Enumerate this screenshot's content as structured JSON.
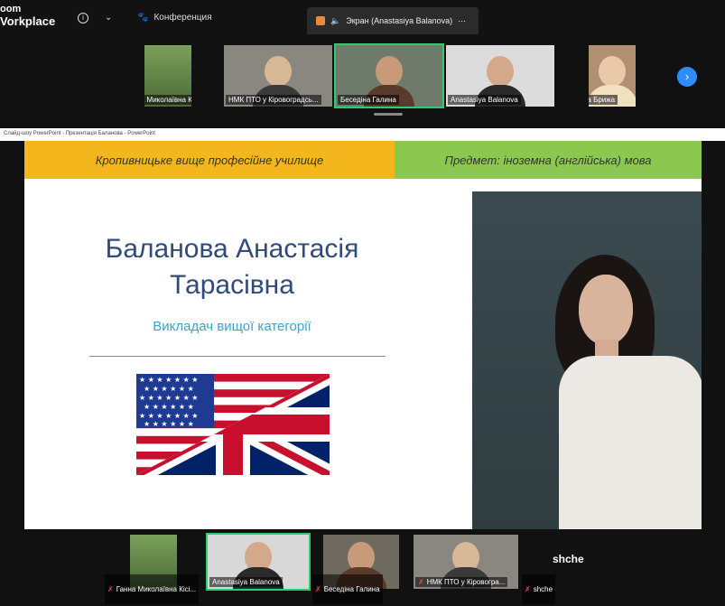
{
  "app": {
    "brand_line1": "oom",
    "brand_line2": "Vorkplace"
  },
  "topbar": {
    "conference_label": "Конференция",
    "screen_label": "Экран (Anastasiya Balanova)"
  },
  "participants_top": [
    {
      "name": "Ганна Миколаївна Кісі..."
    },
    {
      "name": "НМК ПТО у Кіровоградсь..."
    },
    {
      "name": "Беседіна Галина"
    },
    {
      "name": "Anastasiya Balanova"
    },
    {
      "name": "Ольга Брижа"
    }
  ],
  "powerpoint_title": "Слайд-шоу PowerPoint - Презентація Баланова - PowerPoint",
  "slide": {
    "header_left": "Кропивницьке вище професійне училище",
    "header_right": "Предмет: іноземна (англійська) мова",
    "name": "Баланова Анастасія Тарасівна",
    "role": "Викладач вищої категорії"
  },
  "participants_bottom": [
    {
      "name": "Ганна Миколаївна Кісі..."
    },
    {
      "name": "Anastasiya Balanova"
    },
    {
      "name": "Беседіна Галина"
    },
    {
      "name": "НМК ПТО у Кіровогра..."
    },
    {
      "name": "shche"
    }
  ],
  "bottom_name_label": "shche",
  "colors": {
    "accent": "#2d8cff",
    "active_speaker": "#2ecc71",
    "header_left_bg": "#f3b61c",
    "header_right_bg": "#8cc850"
  }
}
